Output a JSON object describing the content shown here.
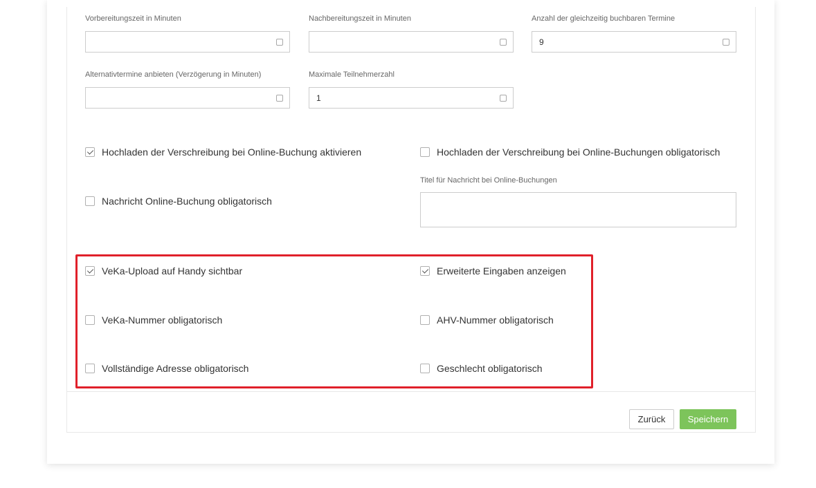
{
  "fields": {
    "prep_time": {
      "label": "Vorbereitungszeit in Minuten",
      "value": ""
    },
    "post_time": {
      "label": "Nachbereitungszeit in Minuten",
      "value": ""
    },
    "concurrent_bookings": {
      "label": "Anzahl der gleichzeitig buchbaren Termine",
      "value": "9"
    },
    "alt_appointments": {
      "label": "Alternativtermine anbieten (Verzögerung in Minuten)",
      "value": ""
    },
    "max_participants": {
      "label": "Maximale Teilnehmerzahl",
      "value": "1"
    }
  },
  "checkboxes": {
    "upload_prescription": {
      "label": "Hochladen der Verschreibung bei Online-Buchung aktivieren",
      "checked": true
    },
    "upload_prescription_required": {
      "label": "Hochladen der Verschreibung bei Online-Buchungen obligatorisch",
      "checked": false
    },
    "message_required": {
      "label": "Nachricht Online-Buchung obligatorisch",
      "checked": false
    },
    "veka_upload_visible": {
      "label": "VeKa-Upload auf Handy sichtbar",
      "checked": true
    },
    "extended_inputs": {
      "label": "Erweiterte Eingaben anzeigen",
      "checked": true
    },
    "veka_number_required": {
      "label": "VeKa-Nummer obligatorisch",
      "checked": false
    },
    "ahv_number_required": {
      "label": "AHV-Nummer obligatorisch",
      "checked": false
    },
    "full_address_required": {
      "label": "Vollständige Adresse obligatorisch",
      "checked": false
    },
    "gender_required": {
      "label": "Geschlecht obligatorisch",
      "checked": false
    }
  },
  "message_title": {
    "label": "Titel für Nachricht bei Online-Buchungen",
    "value": ""
  },
  "buttons": {
    "back": "Zurück",
    "save": "Speichern"
  },
  "colors": {
    "highlight": "#e0202a",
    "save_button": "#7dc45b",
    "border": "#cccccc"
  },
  "icons": {
    "spinner": "spinner-icon",
    "checkmark": "checkmark-icon"
  }
}
